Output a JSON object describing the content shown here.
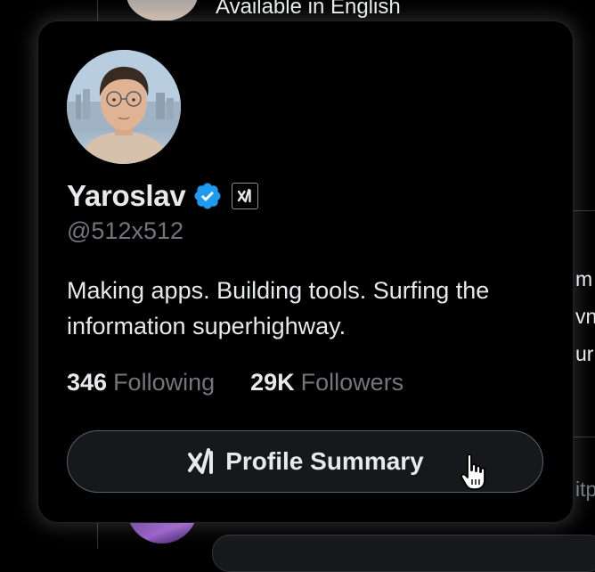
{
  "background": {
    "top_text": "Available in English",
    "snippets": [
      "m",
      "vn",
      "ur",
      "itp"
    ]
  },
  "hover_card": {
    "display_name": "Yaroslav",
    "handle": "@512x512",
    "bio": "Making apps. Building tools. Surfing the information superhighway.",
    "following_count": "346",
    "following_label": "Following",
    "followers_count": "29K",
    "followers_label": "Followers",
    "summary_button_label": "Profile Summary"
  },
  "icons": {
    "verified": "verified-badge-icon",
    "affiliate": "x-ai-affiliate-icon",
    "summary": "grok-icon",
    "cursor": "hand-pointer-cursor-icon"
  },
  "colors": {
    "background": "#000000",
    "primary_text": "#e7e9ea",
    "secondary_text": "#71767b",
    "verified_blue": "#1d9bf0",
    "button_bg": "#16181c",
    "button_border": "#536471"
  }
}
